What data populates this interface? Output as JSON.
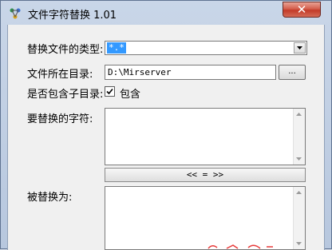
{
  "window": {
    "title": "文件字符替换 1.01",
    "close_label": "✕",
    "icon": "app-icon"
  },
  "form": {
    "file_type_label": "替换文件的类型:",
    "file_type_value": "*.*",
    "dir_label": "文件所在目录:",
    "dir_value": "D:\\Mirserver",
    "browse_label": "...",
    "include_sub_label": "是否包含子目录:",
    "include_sub_text": "包含",
    "include_sub_checked": true,
    "find_label": "要替换的字符:",
    "swap_label": "<< = >>",
    "replace_label": "被替换为:"
  },
  "colors": {
    "selection": "#3399ff",
    "close_button": "#c33b28",
    "watermark": "#e83a3a"
  }
}
